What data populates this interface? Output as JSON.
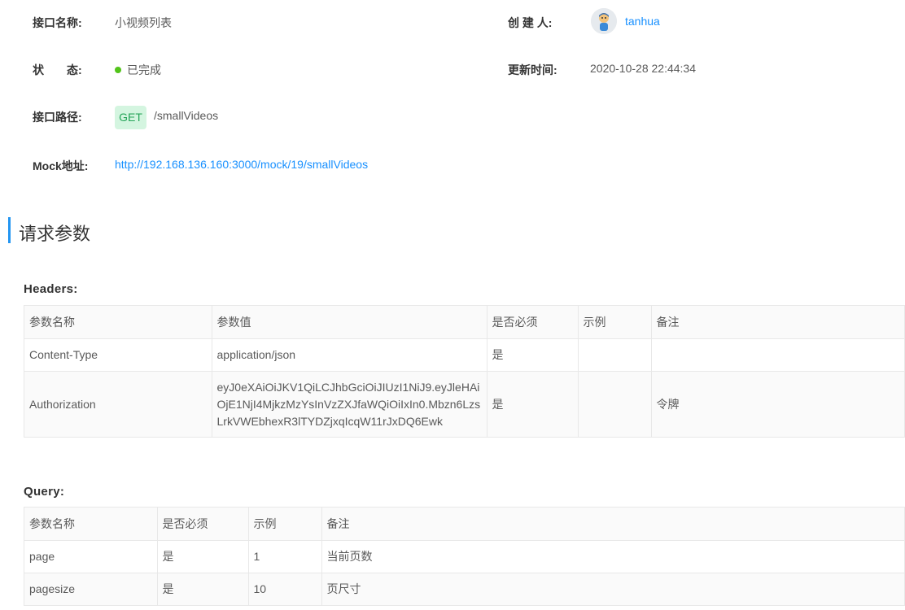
{
  "info": {
    "name_label": "接口名称:",
    "name_value": "小视频列表",
    "creator_label": "创 建 人:",
    "creator_name": "tanhua",
    "status_label": "状　　态:",
    "status_value": "已完成",
    "status_color": "#52c41a",
    "updated_label": "更新时间:",
    "updated_value": "2020-10-28 22:44:34",
    "path_label": "接口路径:",
    "method": "GET",
    "path_value": "/smallVideos",
    "mock_label": "Mock地址:",
    "mock_url": "http://192.168.136.160:3000/mock/19/smallVideos"
  },
  "request_params": {
    "title": "请求参数",
    "headers": {
      "title": "Headers:",
      "columns": [
        "参数名称",
        "参数值",
        "是否必须",
        "示例",
        "备注"
      ],
      "rows": [
        [
          "Content-Type",
          "application/json",
          "是",
          "",
          ""
        ],
        [
          "Authorization",
          "eyJ0eXAiOiJKV1QiLCJhbGciOiJIUzI1NiJ9.eyJleHAiOjE1NjI4MjkzMzYsInVzZXJfaWQiOiIxIn0.Mbzn6LzsLrkVWEbhexR3lTYDZjxqIcqW11rJxDQ6Ewk",
          "是",
          "",
          "令牌"
        ]
      ]
    },
    "query": {
      "title": "Query:",
      "columns": [
        "参数名称",
        "是否必须",
        "示例",
        "备注"
      ],
      "rows": [
        [
          "page",
          "是",
          "1",
          "当前页数"
        ],
        [
          "pagesize",
          "是",
          "10",
          "页尺寸"
        ]
      ]
    }
  },
  "icons": {
    "avatar": "user-avatar-icon"
  },
  "colors": {
    "accent": "#2395f1",
    "link": "#1890ff",
    "method_bg": "#d4f5e0",
    "method_text": "#27a55a"
  }
}
